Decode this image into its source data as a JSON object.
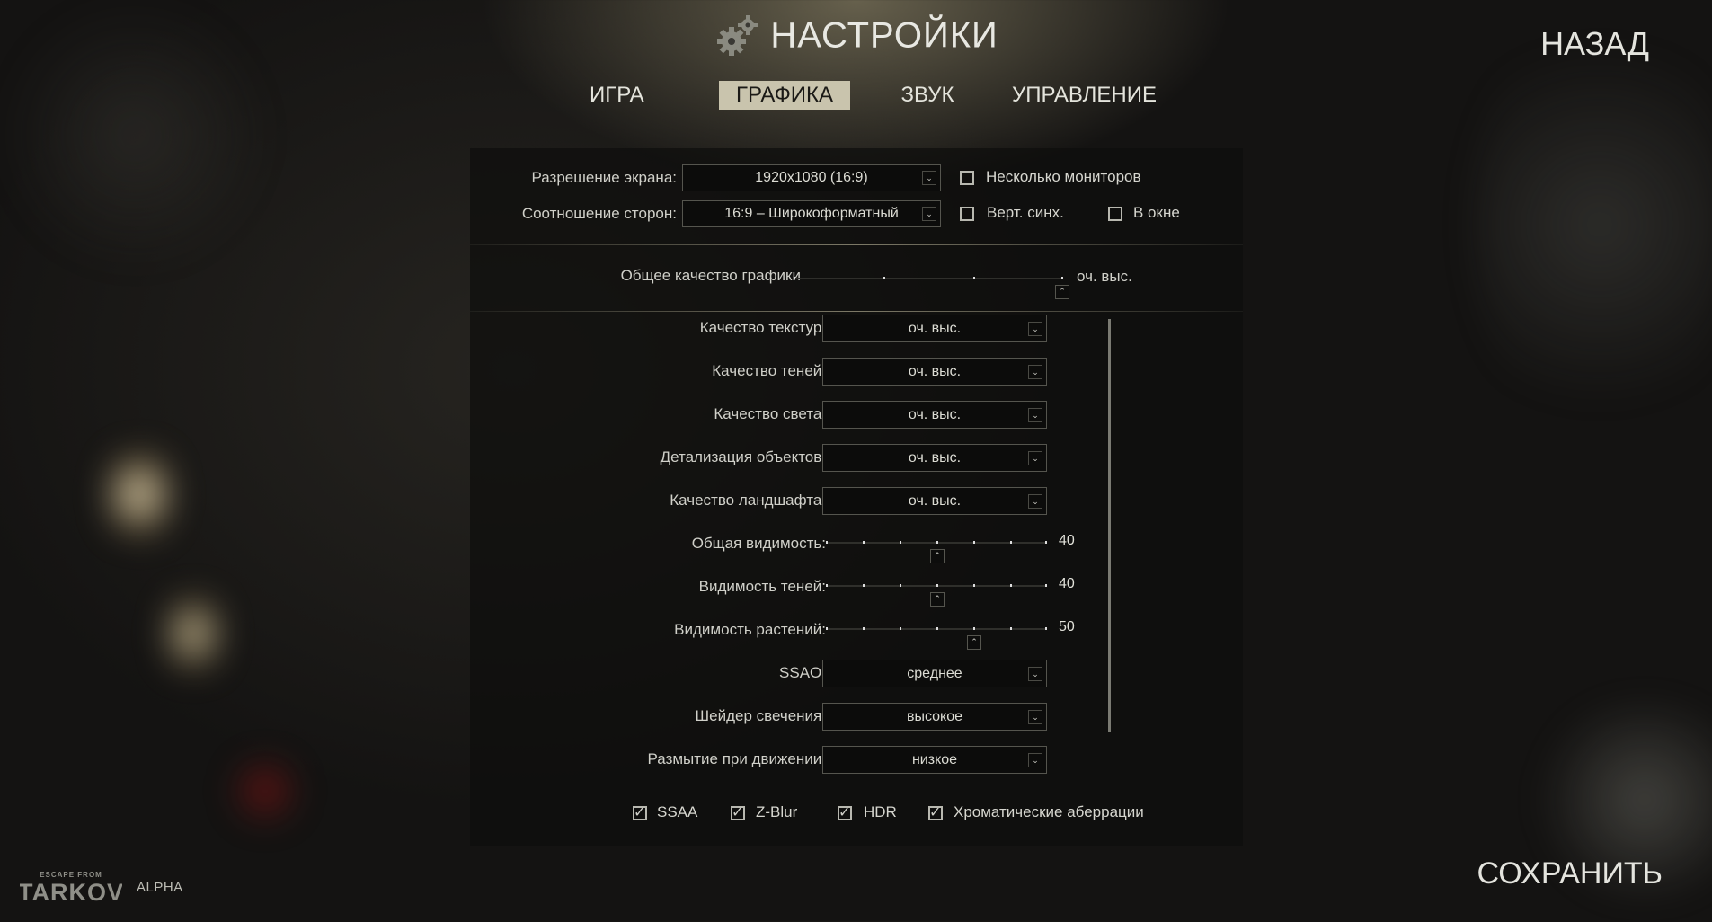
{
  "header": {
    "title": "НАСТРОЙКИ",
    "back_label": "НАЗАД",
    "save_label": "СОХРАНИТЬ"
  },
  "tabs": [
    {
      "label": "ИГРА",
      "active": false
    },
    {
      "label": "ГРАФИКА",
      "active": true
    },
    {
      "label": "ЗВУК",
      "active": false
    },
    {
      "label": "УПРАВЛЕНИЕ",
      "active": false
    }
  ],
  "display": {
    "resolution_label": "Разрешение экрана:",
    "resolution_value": "1920x1080 (16:9)",
    "aspect_label": "Соотношение сторон:",
    "aspect_value": "16:9 – Широкоформатный",
    "multi_monitor_label": "Несколько мониторов",
    "multi_monitor_checked": false,
    "vsync_label": "Верт. синх.",
    "vsync_checked": false,
    "windowed_label": "В окне",
    "windowed_checked": false
  },
  "overall_quality": {
    "label": "Общее качество графики",
    "value": "оч. выс.",
    "level_fraction": 1.0
  },
  "settings": {
    "texture_label": "Качество текстур:",
    "texture_value": "оч. выс.",
    "shadow_label": "Качество теней:",
    "shadow_value": "оч. выс.",
    "light_label": "Качество света:",
    "light_value": "оч. выс.",
    "detail_label": "Детализация объектов:",
    "detail_value": "оч. выс.",
    "landscape_label": "Качество ландшафта:",
    "landscape_value": "оч. выс.",
    "visibility_label": "Общая видимость:",
    "visibility_value": "40",
    "shadow_vis_label": "Видимость теней:",
    "shadow_vis_value": "40",
    "plant_vis_label": "Видимость растений:",
    "plant_vis_value": "50",
    "ssao_label": "SSAO:",
    "ssao_value": "среднее",
    "glow_label": "Шейдер свечения:",
    "glow_value": "высокое",
    "motion_blur_label": "Размытие при движении:",
    "motion_blur_value": "низкое"
  },
  "toggles": [
    {
      "label": "SSAA",
      "checked": true
    },
    {
      "label": "Z-Blur",
      "checked": true
    },
    {
      "label": "HDR",
      "checked": true
    },
    {
      "label": "Хроматические аберрации",
      "checked": true
    }
  ],
  "footer": {
    "logo_text": "ESCAPE FROM TARKOV",
    "badge": "ALPHA"
  },
  "colors": {
    "accent": "#c9c4ad",
    "panel": "#0e0e0d",
    "text": "#d6d6d0"
  },
  "icons": {
    "title": "gear-icon",
    "dropdown": "chevron-down-icon",
    "slider_handle": "chevron-up-icon"
  }
}
